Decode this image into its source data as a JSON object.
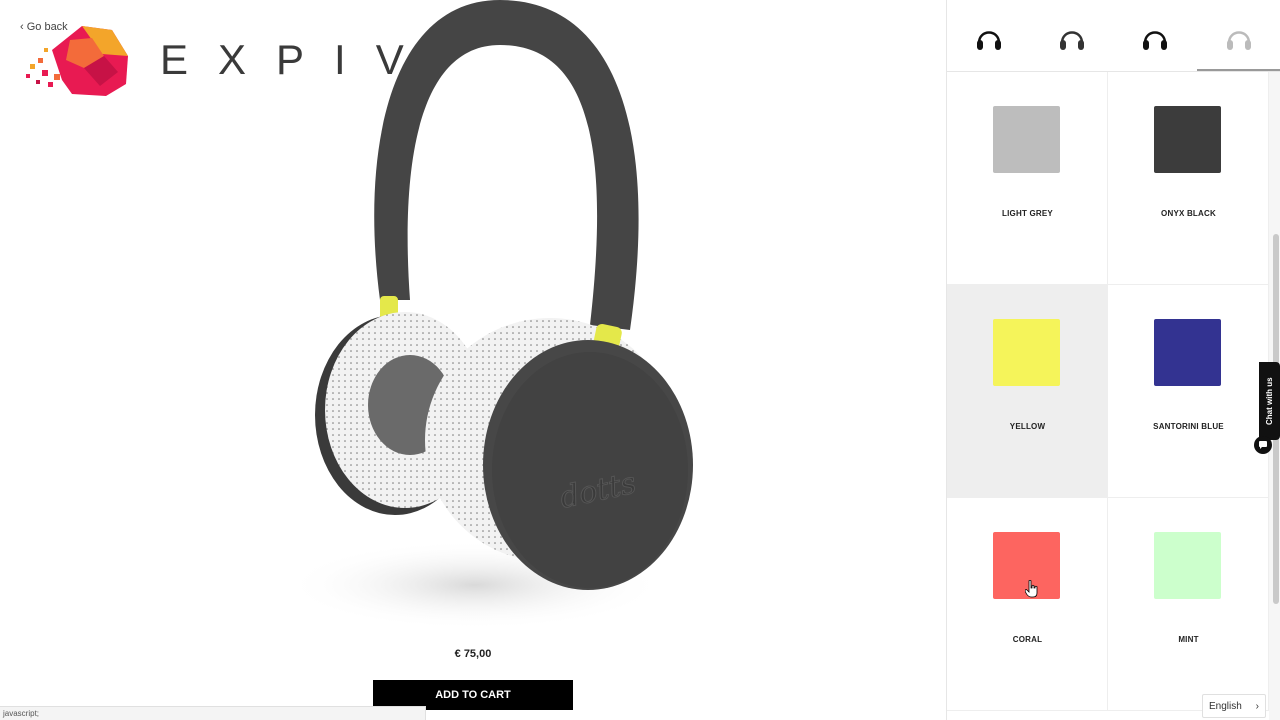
{
  "nav": {
    "go_back": "‹ Go back"
  },
  "brand": {
    "name": "EXPIVI"
  },
  "product": {
    "price": "€ 75,00",
    "add_to_cart": "ADD TO CART",
    "engraving": "dotts"
  },
  "status": {
    "text": "javascript;"
  },
  "thumbnails": [
    {
      "name": "headphone-thumb-1",
      "icon": "headphone-icon",
      "color": "#111111"
    },
    {
      "name": "headphone-thumb-2",
      "icon": "headphone-icon",
      "color": "#333333"
    },
    {
      "name": "headphone-thumb-3",
      "icon": "headphone-icon",
      "color": "#111111"
    },
    {
      "name": "headphone-thumb-4",
      "icon": "headphone-icon",
      "color": "#bbbbbb"
    }
  ],
  "colors": [
    {
      "label": "LIGHT GREY",
      "hex": "#bdbdbd"
    },
    {
      "label": "ONYX BLACK",
      "hex": "#3c3c3c"
    },
    {
      "label": "YELLOW",
      "hex": "#f5f45a"
    },
    {
      "label": "SANTORINI BLUE",
      "hex": "#333391"
    },
    {
      "label": "CORAL",
      "hex": "#fd6560"
    },
    {
      "label": "MINT",
      "hex": "#ccffcc"
    }
  ],
  "selected_color": "YELLOW",
  "chat": {
    "label": "Chat with us"
  },
  "language": {
    "label": "English"
  },
  "theme": {
    "headphone_body": "#444444",
    "accent": "#e4e84a",
    "cushion": "#f2f2f2"
  }
}
